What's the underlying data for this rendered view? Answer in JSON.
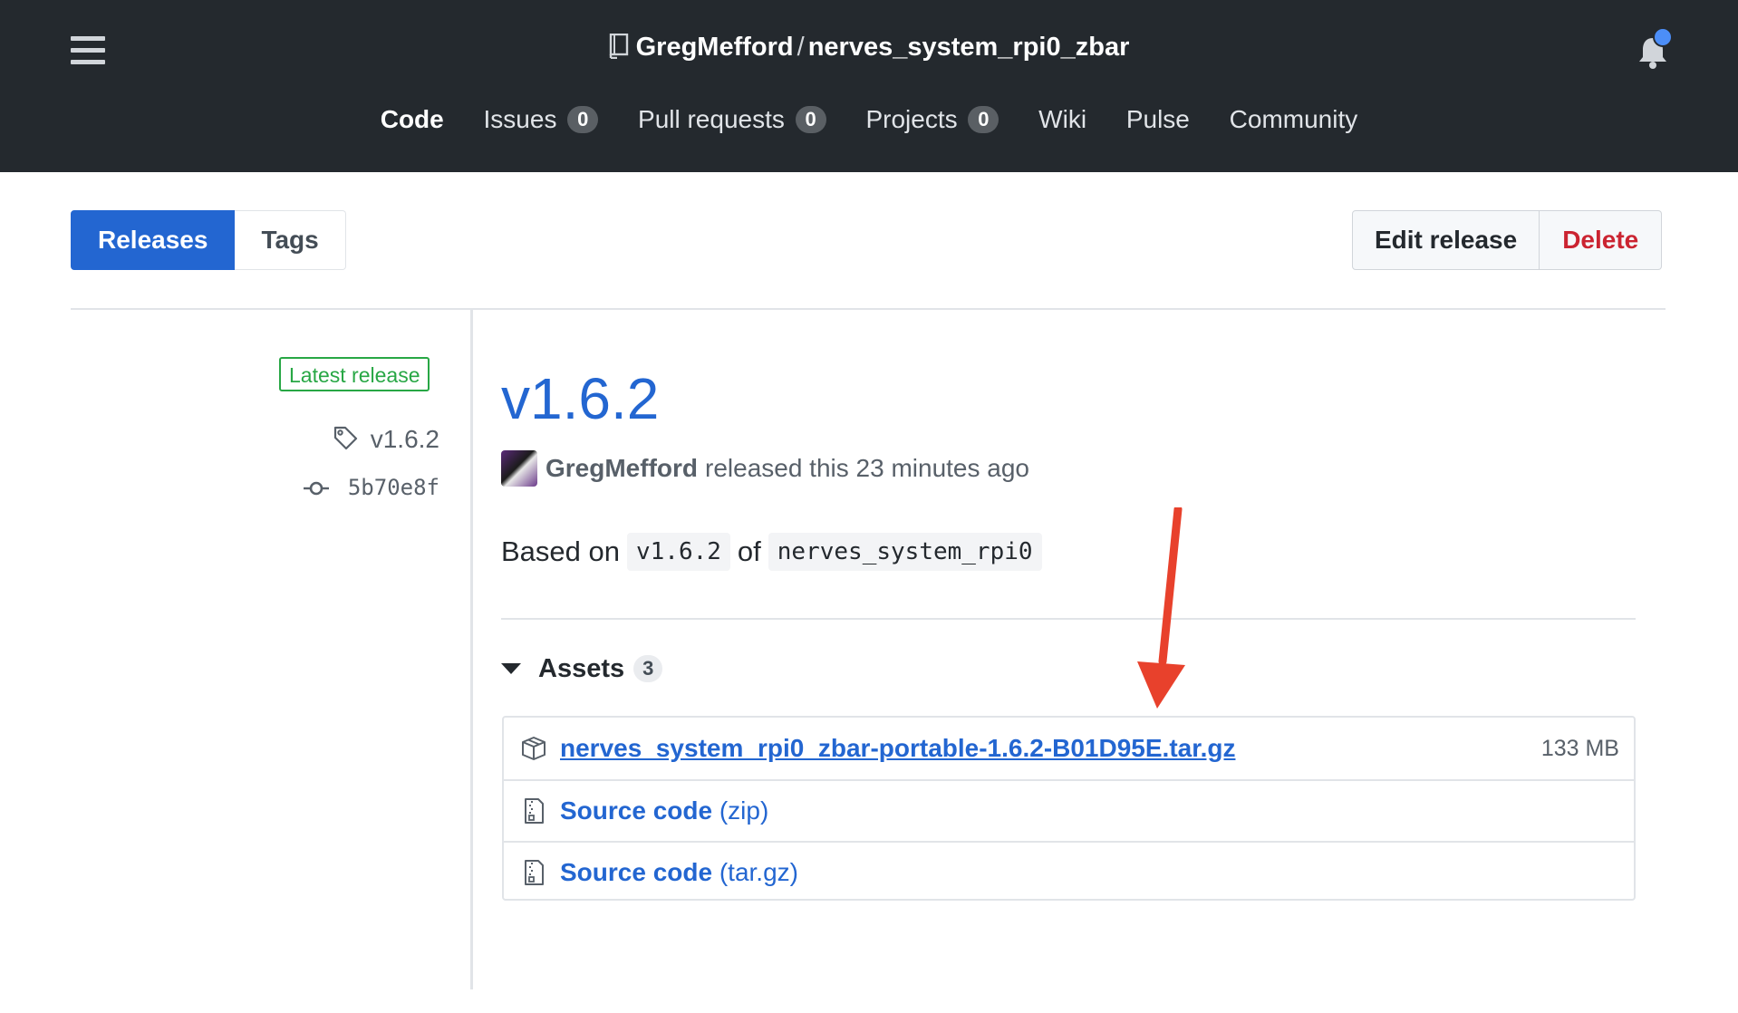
{
  "header": {
    "owner": "GregMefford",
    "separator": "/",
    "repo": "nerves_system_rpi0_zbar",
    "nav": [
      {
        "label": "Code"
      },
      {
        "label": "Issues",
        "count": "0"
      },
      {
        "label": "Pull requests",
        "count": "0"
      },
      {
        "label": "Projects",
        "count": "0"
      },
      {
        "label": "Wiki"
      },
      {
        "label": "Pulse"
      },
      {
        "label": "Community"
      }
    ]
  },
  "subnav": {
    "releases_label": "Releases",
    "tags_label": "Tags",
    "edit_label": "Edit release",
    "delete_label": "Delete"
  },
  "meta": {
    "latest_label": "Latest release",
    "tag": "v1.6.2",
    "commit": "5b70e8f"
  },
  "release": {
    "title": "v1.6.2",
    "author": "GregMefford",
    "released_text": "released this 23 minutes ago",
    "based_on_prefix": "Based on",
    "based_version": "v1.6.2",
    "based_of": "of",
    "based_repo": "nerves_system_rpi0"
  },
  "assets": {
    "label": "Assets",
    "count": "3",
    "items": [
      {
        "name": "nerves_system_rpi0_zbar-portable-1.6.2-B01D95E.tar.gz",
        "size": "133 MB",
        "icon": "package-icon"
      },
      {
        "name": "Source code",
        "format": "(zip)",
        "icon": "file-zip-icon"
      },
      {
        "name": "Source code",
        "format": "(tar.gz)",
        "icon": "file-zip-icon"
      }
    ]
  },
  "colors": {
    "header_bg": "#24292e",
    "accent_blue": "#2366d1",
    "latest_green": "#28a745",
    "delete_red": "#cb2431",
    "annotation_red": "#e8412c"
  }
}
